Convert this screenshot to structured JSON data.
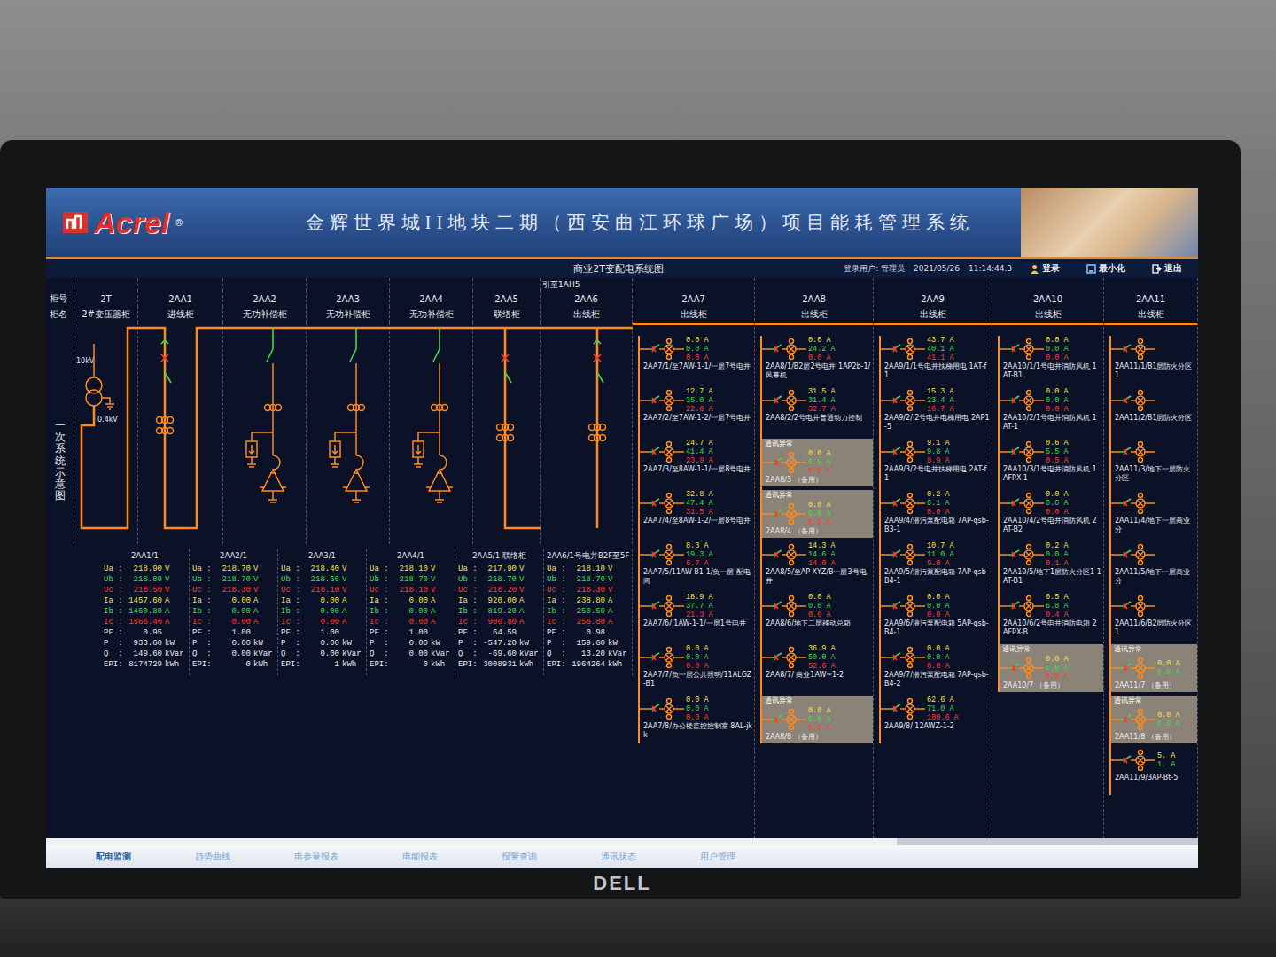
{
  "header": {
    "logo": "Acrel",
    "logo_mark": "®",
    "title": "金辉世界城II地块二期（西安曲江环球广场）项目能耗管理系统"
  },
  "subbar": {
    "diagram_title": "商业2T变配电系统图",
    "user_label": "登录用户:",
    "user": "管理员",
    "date": "2021/05/26",
    "time": "11:14:44.3",
    "buttons": [
      {
        "label": "登录",
        "kind": "user"
      },
      {
        "label": "最小化",
        "kind": "minimize"
      },
      {
        "label": "退出",
        "kind": "exit"
      }
    ]
  },
  "row_labels": {
    "number": "柜号",
    "name": "柜名"
  },
  "side_label": "一次系统示意图",
  "transformer": {
    "hv": "10kV",
    "lv": "0.4kV"
  },
  "columns": [
    {
      "id": "2T",
      "name": "2#变压器柜",
      "kind": "transformer",
      "note": ""
    },
    {
      "id": "2AA1",
      "name": "进线柜",
      "kind": "incomer",
      "note": ""
    },
    {
      "id": "2AA2",
      "name": "无功补偿柜",
      "kind": "capacitor",
      "note": ""
    },
    {
      "id": "2AA3",
      "name": "无功补偿柜",
      "kind": "capacitor",
      "note": ""
    },
    {
      "id": "2AA4",
      "name": "无功补偿柜",
      "kind": "capacitor",
      "note": ""
    },
    {
      "id": "2AA5",
      "name": "联络柜",
      "kind": "tie",
      "note": ""
    },
    {
      "id": "2AA6",
      "name": "出线柜",
      "kind": "outgoing",
      "note": "引至1AH5"
    }
  ],
  "meters": [
    {
      "title": "2AA1/1",
      "rows": [
        {
          "label": "Ua :",
          "value": "218.90",
          "unit": "V",
          "color": "#f2e24a"
        },
        {
          "label": "Ub :",
          "value": "218.80",
          "unit": "V",
          "color": "#3fdc4c"
        },
        {
          "label": "Uc :",
          "value": "218.50",
          "unit": "V",
          "color": "#ff3b2e"
        },
        {
          "label": "Ia :",
          "value": "1457.60",
          "unit": "A",
          "color": "#f2e24a"
        },
        {
          "label": "Ib :",
          "value": "1460.80",
          "unit": "A",
          "color": "#3fdc4c"
        },
        {
          "label": "Ic :",
          "value": "1566.40",
          "unit": "A",
          "color": "#ff3b2e"
        },
        {
          "label": "PF :",
          "value": "0.95",
          "unit": "",
          "color": "#e6e8ee"
        },
        {
          "label": "P  :",
          "value": "933.60",
          "unit": "kW",
          "color": "#e6e8ee"
        },
        {
          "label": "Q  :",
          "value": "149.60",
          "unit": "kVar",
          "color": "#e6e8ee"
        },
        {
          "label": "EPI:",
          "value": "8174729",
          "unit": "kWh",
          "color": "#e6e8ee"
        }
      ]
    },
    {
      "title": "2AA2/1",
      "rows": [
        {
          "label": "Ua :",
          "value": "218.70",
          "unit": "V",
          "color": "#f2e24a"
        },
        {
          "label": "Ub :",
          "value": "218.70",
          "unit": "V",
          "color": "#3fdc4c"
        },
        {
          "label": "Uc :",
          "value": "218.30",
          "unit": "V",
          "color": "#ff3b2e"
        },
        {
          "label": "Ia :",
          "value": "0.00",
          "unit": "A",
          "color": "#f2e24a"
        },
        {
          "label": "Ib :",
          "value": "0.00",
          "unit": "A",
          "color": "#3fdc4c"
        },
        {
          "label": "Ic :",
          "value": "0.00",
          "unit": "A",
          "color": "#ff3b2e"
        },
        {
          "label": "PF :",
          "value": "1.00",
          "unit": "",
          "color": "#e6e8ee"
        },
        {
          "label": "P  :",
          "value": "0.00",
          "unit": "kW",
          "color": "#e6e8ee"
        },
        {
          "label": "Q  :",
          "value": "0.00",
          "unit": "kVar",
          "color": "#e6e8ee"
        },
        {
          "label": "EPI:",
          "value": "0",
          "unit": "kWh",
          "color": "#e6e8ee"
        }
      ]
    },
    {
      "title": "2AA3/1",
      "rows": [
        {
          "label": "Ua :",
          "value": "218.40",
          "unit": "V",
          "color": "#f2e24a"
        },
        {
          "label": "Ub :",
          "value": "218.60",
          "unit": "V",
          "color": "#3fdc4c"
        },
        {
          "label": "Uc :",
          "value": "218.10",
          "unit": "V",
          "color": "#ff3b2e"
        },
        {
          "label": "Ia :",
          "value": "0.00",
          "unit": "A",
          "color": "#f2e24a"
        },
        {
          "label": "Ib :",
          "value": "0.00",
          "unit": "A",
          "color": "#3fdc4c"
        },
        {
          "label": "Ic :",
          "value": "0.00",
          "unit": "A",
          "color": "#ff3b2e"
        },
        {
          "label": "PF :",
          "value": "1.00",
          "unit": "",
          "color": "#e6e8ee"
        },
        {
          "label": "P  :",
          "value": "0.00",
          "unit": "kW",
          "color": "#e6e8ee"
        },
        {
          "label": "Q  :",
          "value": "0.00",
          "unit": "kVar",
          "color": "#e6e8ee"
        },
        {
          "label": "EPI:",
          "value": "1",
          "unit": "kWh",
          "color": "#e6e8ee"
        }
      ]
    },
    {
      "title": "2AA4/1",
      "rows": [
        {
          "label": "Ua :",
          "value": "218.10",
          "unit": "V",
          "color": "#f2e24a"
        },
        {
          "label": "Ub :",
          "value": "218.70",
          "unit": "V",
          "color": "#3fdc4c"
        },
        {
          "label": "Uc :",
          "value": "218.10",
          "unit": "V",
          "color": "#ff3b2e"
        },
        {
          "label": "Ia :",
          "value": "0.00",
          "unit": "A",
          "color": "#f2e24a"
        },
        {
          "label": "Ib :",
          "value": "0.00",
          "unit": "A",
          "color": "#3fdc4c"
        },
        {
          "label": "Ic :",
          "value": "0.00",
          "unit": "A",
          "color": "#ff3b2e"
        },
        {
          "label": "PF :",
          "value": "1.00",
          "unit": "",
          "color": "#e6e8ee"
        },
        {
          "label": "P  :",
          "value": "0.00",
          "unit": "kW",
          "color": "#e6e8ee"
        },
        {
          "label": "Q  :",
          "value": "0.00",
          "unit": "kVar",
          "color": "#e6e8ee"
        },
        {
          "label": "EPI:",
          "value": "0",
          "unit": "kWh",
          "color": "#e6e8ee"
        }
      ]
    },
    {
      "title": "2AA5/1 联络柜",
      "rows": [
        {
          "label": "Ua :",
          "value": "217.90",
          "unit": "V",
          "color": "#f2e24a"
        },
        {
          "label": "Ub :",
          "value": "218.70",
          "unit": "V",
          "color": "#3fdc4c"
        },
        {
          "label": "Uc :",
          "value": "218.20",
          "unit": "V",
          "color": "#ff3b2e"
        },
        {
          "label": "Ia :",
          "value": "920.00",
          "unit": "A",
          "color": "#f2e24a"
        },
        {
          "label": "Ib :",
          "value": "819.20",
          "unit": "A",
          "color": "#3fdc4c"
        },
        {
          "label": "Ic :",
          "value": "900.80",
          "unit": "A",
          "color": "#ff3b2e"
        },
        {
          "label": "PF :",
          "value": "64.59",
          "unit": "",
          "color": "#e6e8ee"
        },
        {
          "label": "P  :",
          "value": "-547.20",
          "unit": "kW",
          "color": "#e6e8ee"
        },
        {
          "label": "Q  :",
          "value": "-69.60",
          "unit": "kVar",
          "color": "#e6e8ee"
        },
        {
          "label": "EPI:",
          "value": "3008931",
          "unit": "kWh",
          "color": "#e6e8ee"
        }
      ]
    },
    {
      "title": "2AA6/1号电井B2F至5F",
      "rows": [
        {
          "label": "Ua :",
          "value": "218.10",
          "unit": "V",
          "color": "#f2e24a"
        },
        {
          "label": "Ub :",
          "value": "218.70",
          "unit": "V",
          "color": "#3fdc4c"
        },
        {
          "label": "Uc :",
          "value": "218.30",
          "unit": "V",
          "color": "#ff3b2e"
        },
        {
          "label": "Ia :",
          "value": "238.80",
          "unit": "A",
          "color": "#f2e24a"
        },
        {
          "label": "Ib :",
          "value": "250.50",
          "unit": "A",
          "color": "#3fdc4c"
        },
        {
          "label": "Ic :",
          "value": "256.80",
          "unit": "A",
          "color": "#ff3b2e"
        },
        {
          "label": "PF :",
          "value": "0.98",
          "unit": "",
          "color": "#e6e8ee"
        },
        {
          "label": "P  :",
          "value": "159.60",
          "unit": "kW",
          "color": "#e6e8ee"
        },
        {
          "label": "Q  :",
          "value": "13.20",
          "unit": "kVar",
          "color": "#e6e8ee"
        },
        {
          "label": "EPI:",
          "value": "1964264",
          "unit": "kWh",
          "color": "#e6e8ee"
        }
      ]
    }
  ],
  "feeders": [
    {
      "id": "2AA7",
      "name": "出线柜",
      "unit": "A",
      "items": [
        {
          "label": "2AA7/1/至7AW-1-1/一层7号电井",
          "values": [
            "0.0",
            "0.0",
            "0.0"
          ],
          "fault": false
        },
        {
          "label": "2AA7/2/至7AW-1-2/一层7号电井",
          "values": [
            "12.7",
            "35.0",
            "22.6"
          ],
          "fault": false
        },
        {
          "label": "2AA7/3/至8AW-1-1/一层8号电井",
          "values": [
            "24.7",
            "41.4",
            "23.9"
          ],
          "fault": false
        },
        {
          "label": "2AA7/4/至8AW-1-2/一层8号电井",
          "values": [
            "32.8",
            "47.4",
            "31.5"
          ],
          "fault": false
        },
        {
          "label": "2AA7/5/11AW-B1-1/负一层 配电间",
          "values": [
            "8.3",
            "19.3",
            "6.7"
          ],
          "fault": false
        },
        {
          "label": "2AA7/6/ 1AW-1-1/一层1号电井",
          "values": [
            "18.9",
            "37.7",
            "21.3"
          ],
          "fault": false
        },
        {
          "label": "2AA7/7/负一层公共照明/11ALGZ-B1",
          "values": [
            "0.0",
            "0.0",
            "0.0"
          ],
          "fault": false
        },
        {
          "label": "2AA7/8/办公楼监控控制室 8AL-jkk",
          "values": [
            "0.0",
            "0.0",
            "0.0"
          ],
          "fault": false
        }
      ]
    },
    {
      "id": "2AA8",
      "name": "出线柜",
      "unit": "A",
      "items": [
        {
          "label": "2AA8/1/B2层2号电井 1AP2b-1/风幕机",
          "values": [
            "0.0",
            "24.2",
            "0.0"
          ],
          "fault": false
        },
        {
          "label": "2AA8/2/2号电井普通动力控制",
          "values": [
            "31.5",
            "31.4",
            "32.7"
          ],
          "fault": false
        },
        {
          "label": "2AA8/3 （备用）",
          "values": [
            "0.0",
            "0.0",
            "0.0"
          ],
          "fault": true,
          "status": "通讯异常"
        },
        {
          "label": "2AA8/4 （备用）",
          "values": [
            "0.0",
            "0.0",
            "0.0"
          ],
          "fault": true,
          "status": "通讯异常"
        },
        {
          "label": "2AA8/5/至AP-XYZ/B一层3号电井",
          "values": [
            "14.3",
            "14.6",
            "14.0"
          ],
          "fault": false
        },
        {
          "label": "2AA8/6/地下二层移动总箱",
          "values": [
            "0.0",
            "0.0",
            "0.0"
          ],
          "fault": false
        },
        {
          "label": "2AA8/7/ 商业1AW~1-2",
          "values": [
            "36.9",
            "50.0",
            "52.6"
          ],
          "fault": false
        },
        {
          "label": "2AA8/8 （备用）",
          "values": [
            "0.0",
            "0.0",
            "0.0"
          ],
          "fault": true,
          "status": "通讯异常"
        }
      ]
    },
    {
      "id": "2AA9",
      "name": "出线柜",
      "unit": "A",
      "items": [
        {
          "label": "2AA9/1/1号电井扶梯用电 1AT-f1",
          "values": [
            "43.7",
            "40.1",
            "41.1"
          ],
          "fault": false
        },
        {
          "label": "2AA9/2/ 2号电井电梯用电 2AP1-5",
          "values": [
            "15.3",
            "23.4",
            "16.7"
          ],
          "fault": false
        },
        {
          "label": "2AA9/3/2号电井扶梯用电 2AT-f1",
          "values": [
            "9.1",
            "9.8",
            "8.9"
          ],
          "fault": false
        },
        {
          "label": "2AA9/4/潜污泵配电箱 7AP-qsb-B3-1",
          "values": [
            "0.2",
            "0.1",
            "0.0"
          ],
          "fault": false
        },
        {
          "label": "2AA9/5/潜污泵配电箱 7AP-qsb-B4-1",
          "values": [
            "10.7",
            "11.0",
            "9.0"
          ],
          "fault": false
        },
        {
          "label": "2AA9/6/潜污泵配电箱 5AP-qsb-B4-1",
          "values": [
            "0.0",
            "0.0",
            "0.0"
          ],
          "fault": false
        },
        {
          "label": "2AA9/7/潜污泵配电箱 7AP-qsb-B4-2",
          "values": [
            "0.0",
            "0.0",
            "0.0"
          ],
          "fault": false
        },
        {
          "label": "2AA9/8/ 12AWZ-1-2",
          "values": [
            "62.6",
            "71.0",
            "100.6"
          ],
          "fault": false
        }
      ]
    },
    {
      "id": "2AA10",
      "name": "出线柜",
      "unit": "A",
      "items": [
        {
          "label": "2AA10/1/1号电井消防风机 1AT-B1",
          "values": [
            "0.0",
            "0.0",
            "0.0"
          ],
          "fault": false
        },
        {
          "label": "2AA10/2/1号电井消防风机 1AT-1",
          "values": [
            "0.0",
            "0.0",
            "0.0"
          ],
          "fault": false
        },
        {
          "label": "2AA10/3/1号电井消防风机 1AFPX-1",
          "values": [
            "0.6",
            "5.5",
            "0.5"
          ],
          "fault": false
        },
        {
          "label": "2AA10/4/2号电井消防风机 2AT-B2",
          "values": [
            "0.0",
            "0.0",
            "0.0"
          ],
          "fault": false
        },
        {
          "label": "2AA10/5/地下1层防火分区1 1AT-B1",
          "values": [
            "0.2",
            "0.0",
            "0.1"
          ],
          "fault": false
        },
        {
          "label": "2AA10/6/2号电井消防电箱 2AFPX-B",
          "values": [
            "0.5",
            "6.8",
            "0.4"
          ],
          "fault": false
        },
        {
          "label": "2AA10/7 （备用）",
          "values": [
            "0.0",
            "0.0",
            "0.0"
          ],
          "fault": true,
          "status": "通讯异常"
        }
      ]
    },
    {
      "id": "2AA11",
      "name": "出线柜",
      "unit": "A",
      "items": [
        {
          "label": "2AA11/1/B1层防火分区1",
          "values": [],
          "fault": false
        },
        {
          "label": "2AA11/2/B1层防火分区",
          "values": [],
          "fault": false
        },
        {
          "label": "2AA11/3/地下一层防火分区",
          "values": [],
          "fault": false
        },
        {
          "label": "2AA11/4/地下一层商业分",
          "values": [],
          "fault": false
        },
        {
          "label": "2AA11/5/地下一层商业分",
          "values": [],
          "fault": false
        },
        {
          "label": "2AA11/6/B2层防火分区1",
          "values": [],
          "fault": false
        },
        {
          "label": "2AA11/7 （备用）",
          "values": [
            "0.0",
            "0.0"
          ],
          "fault": true,
          "status": "通讯异常"
        },
        {
          "label": "2AA11/8 （备用）",
          "values": [
            "0.0",
            "0.0"
          ],
          "fault": true,
          "status": "通讯异常"
        },
        {
          "label": "2AA11/9/3AP-Bt-5",
          "values": [
            "5.",
            "1."
          ],
          "fault": false
        }
      ]
    }
  ],
  "nav": [
    {
      "label": "配电监测",
      "selected": true
    },
    {
      "label": "趋势曲线",
      "selected": false
    },
    {
      "label": "电参量报表",
      "selected": false
    },
    {
      "label": "电能报表",
      "selected": false
    },
    {
      "label": "报警查询",
      "selected": false
    },
    {
      "label": "通讯状态",
      "selected": false
    },
    {
      "label": "用户管理",
      "selected": false
    }
  ],
  "monitor": {
    "brand": "DELL"
  }
}
